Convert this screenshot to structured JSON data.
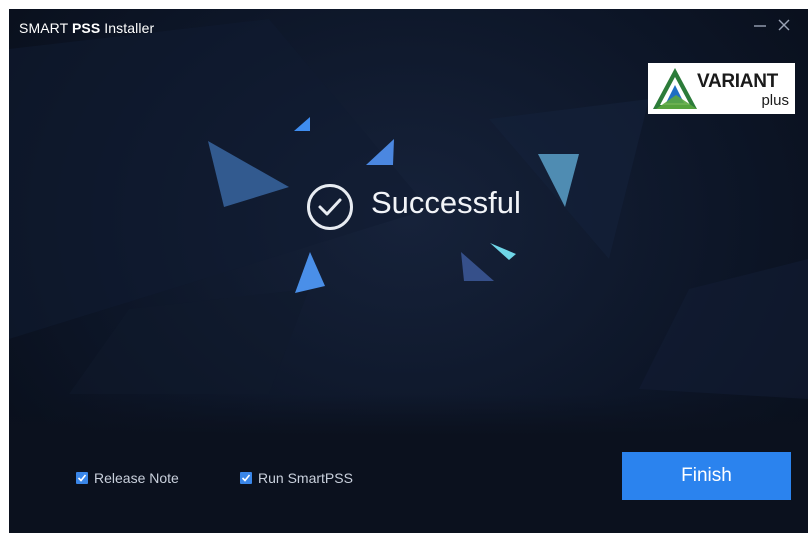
{
  "window": {
    "title_prefix": "SMART ",
    "title_brand": "PSS",
    "title_suffix": " Installer",
    "minimize_glyph": "—",
    "close_glyph": "✕"
  },
  "logo": {
    "main": "VARIANT",
    "sub": "plus"
  },
  "status": {
    "icon": "check-circle-icon",
    "text": "Successful"
  },
  "options": {
    "release_note": {
      "label": "Release Note",
      "checked": true
    },
    "run_smartpss": {
      "label": "Run SmartPSS",
      "checked": true
    }
  },
  "actions": {
    "finish_label": "Finish"
  },
  "colors": {
    "background": "#0d1628",
    "accent": "#2b83ee",
    "checkbox": "#3a86e8",
    "text": "#f2f4f8"
  }
}
